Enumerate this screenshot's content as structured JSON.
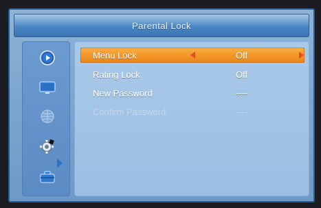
{
  "window": {
    "title": "Parental Lock"
  },
  "sidebar": {
    "icons": [
      "play-circle-icon",
      "tv-screen-icon",
      "globe-icon",
      "gear-icon",
      "toolbox-icon"
    ],
    "selected_index": 3
  },
  "menu": {
    "items": [
      {
        "label": "Menu Lock",
        "value": "Off",
        "selected": true,
        "enabled": true
      },
      {
        "label": "Rating Lock",
        "value": "Off",
        "selected": false,
        "enabled": true
      },
      {
        "label": "New Password",
        "value": "----",
        "selected": false,
        "enabled": true
      },
      {
        "label": "Confirm Password",
        "value": "----",
        "selected": false,
        "enabled": false
      }
    ]
  },
  "colors": {
    "highlight": "#f39a2a",
    "accent_blue": "#2c70c8",
    "arrow_red": "#e34a2c"
  }
}
